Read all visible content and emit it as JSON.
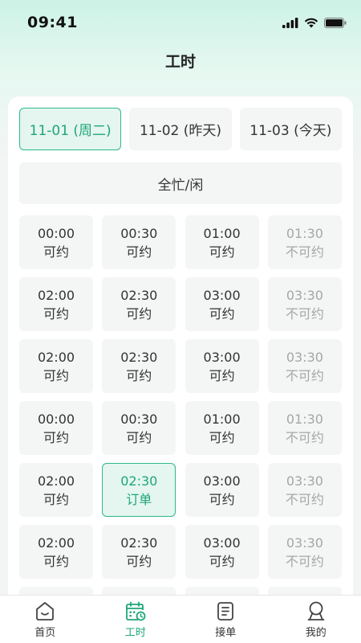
{
  "status_bar": {
    "time": "09:41"
  },
  "page": {
    "title": "工时"
  },
  "date_tabs": [
    {
      "label": "11-01 (周二)",
      "active": true
    },
    {
      "label": "11-02 (昨天)",
      "active": false
    },
    {
      "label": "11-03 (今天)",
      "active": false
    }
  ],
  "all_toggle": {
    "label": "全忙/闲"
  },
  "slots": [
    {
      "time": "00:00",
      "status": "可约",
      "state": "available"
    },
    {
      "time": "00:30",
      "status": "可约",
      "state": "available"
    },
    {
      "time": "01:00",
      "status": "可约",
      "state": "available"
    },
    {
      "time": "01:30",
      "status": "不可约",
      "state": "unavailable"
    },
    {
      "time": "02:00",
      "status": "可约",
      "state": "available"
    },
    {
      "time": "02:30",
      "status": "可约",
      "state": "available"
    },
    {
      "time": "03:00",
      "status": "可约",
      "state": "available"
    },
    {
      "time": "03:30",
      "status": "不可约",
      "state": "unavailable"
    },
    {
      "time": "02:00",
      "status": "可约",
      "state": "available"
    },
    {
      "time": "02:30",
      "status": "可约",
      "state": "available"
    },
    {
      "time": "03:00",
      "status": "可约",
      "state": "available"
    },
    {
      "time": "03:30",
      "status": "不可约",
      "state": "unavailable"
    },
    {
      "time": "00:00",
      "status": "可约",
      "state": "available"
    },
    {
      "time": "00:30",
      "status": "可约",
      "state": "available"
    },
    {
      "time": "01:00",
      "status": "可约",
      "state": "available"
    },
    {
      "time": "01:30",
      "status": "不可约",
      "state": "unavailable"
    },
    {
      "time": "02:00",
      "status": "可约",
      "state": "available"
    },
    {
      "time": "02:30",
      "status": "订单",
      "state": "booked"
    },
    {
      "time": "03:00",
      "status": "可约",
      "state": "available"
    },
    {
      "time": "03:30",
      "status": "不可约",
      "state": "unavailable"
    },
    {
      "time": "02:00",
      "status": "可约",
      "state": "available"
    },
    {
      "time": "02:30",
      "status": "可约",
      "state": "available"
    },
    {
      "time": "03:00",
      "status": "可约",
      "state": "available"
    },
    {
      "time": "03:30",
      "status": "不可约",
      "state": "unavailable"
    },
    {
      "time": "",
      "status": "",
      "state": "available"
    },
    {
      "time": "",
      "status": "",
      "state": "available"
    },
    {
      "time": "",
      "status": "",
      "state": "available"
    },
    {
      "time": "",
      "status": "",
      "state": "available"
    }
  ],
  "bottom_nav": [
    {
      "label": "首页",
      "icon": "home-icon",
      "active": false
    },
    {
      "label": "工时",
      "icon": "calendar-clock-icon",
      "active": true
    },
    {
      "label": "接单",
      "icon": "clipboard-icon",
      "active": false
    },
    {
      "label": "我的",
      "icon": "user-icon",
      "active": false
    }
  ],
  "colors": {
    "accent": "#1fa578",
    "accent_bg": "#e4f6ef",
    "tile_bg": "#f4f5f5"
  }
}
